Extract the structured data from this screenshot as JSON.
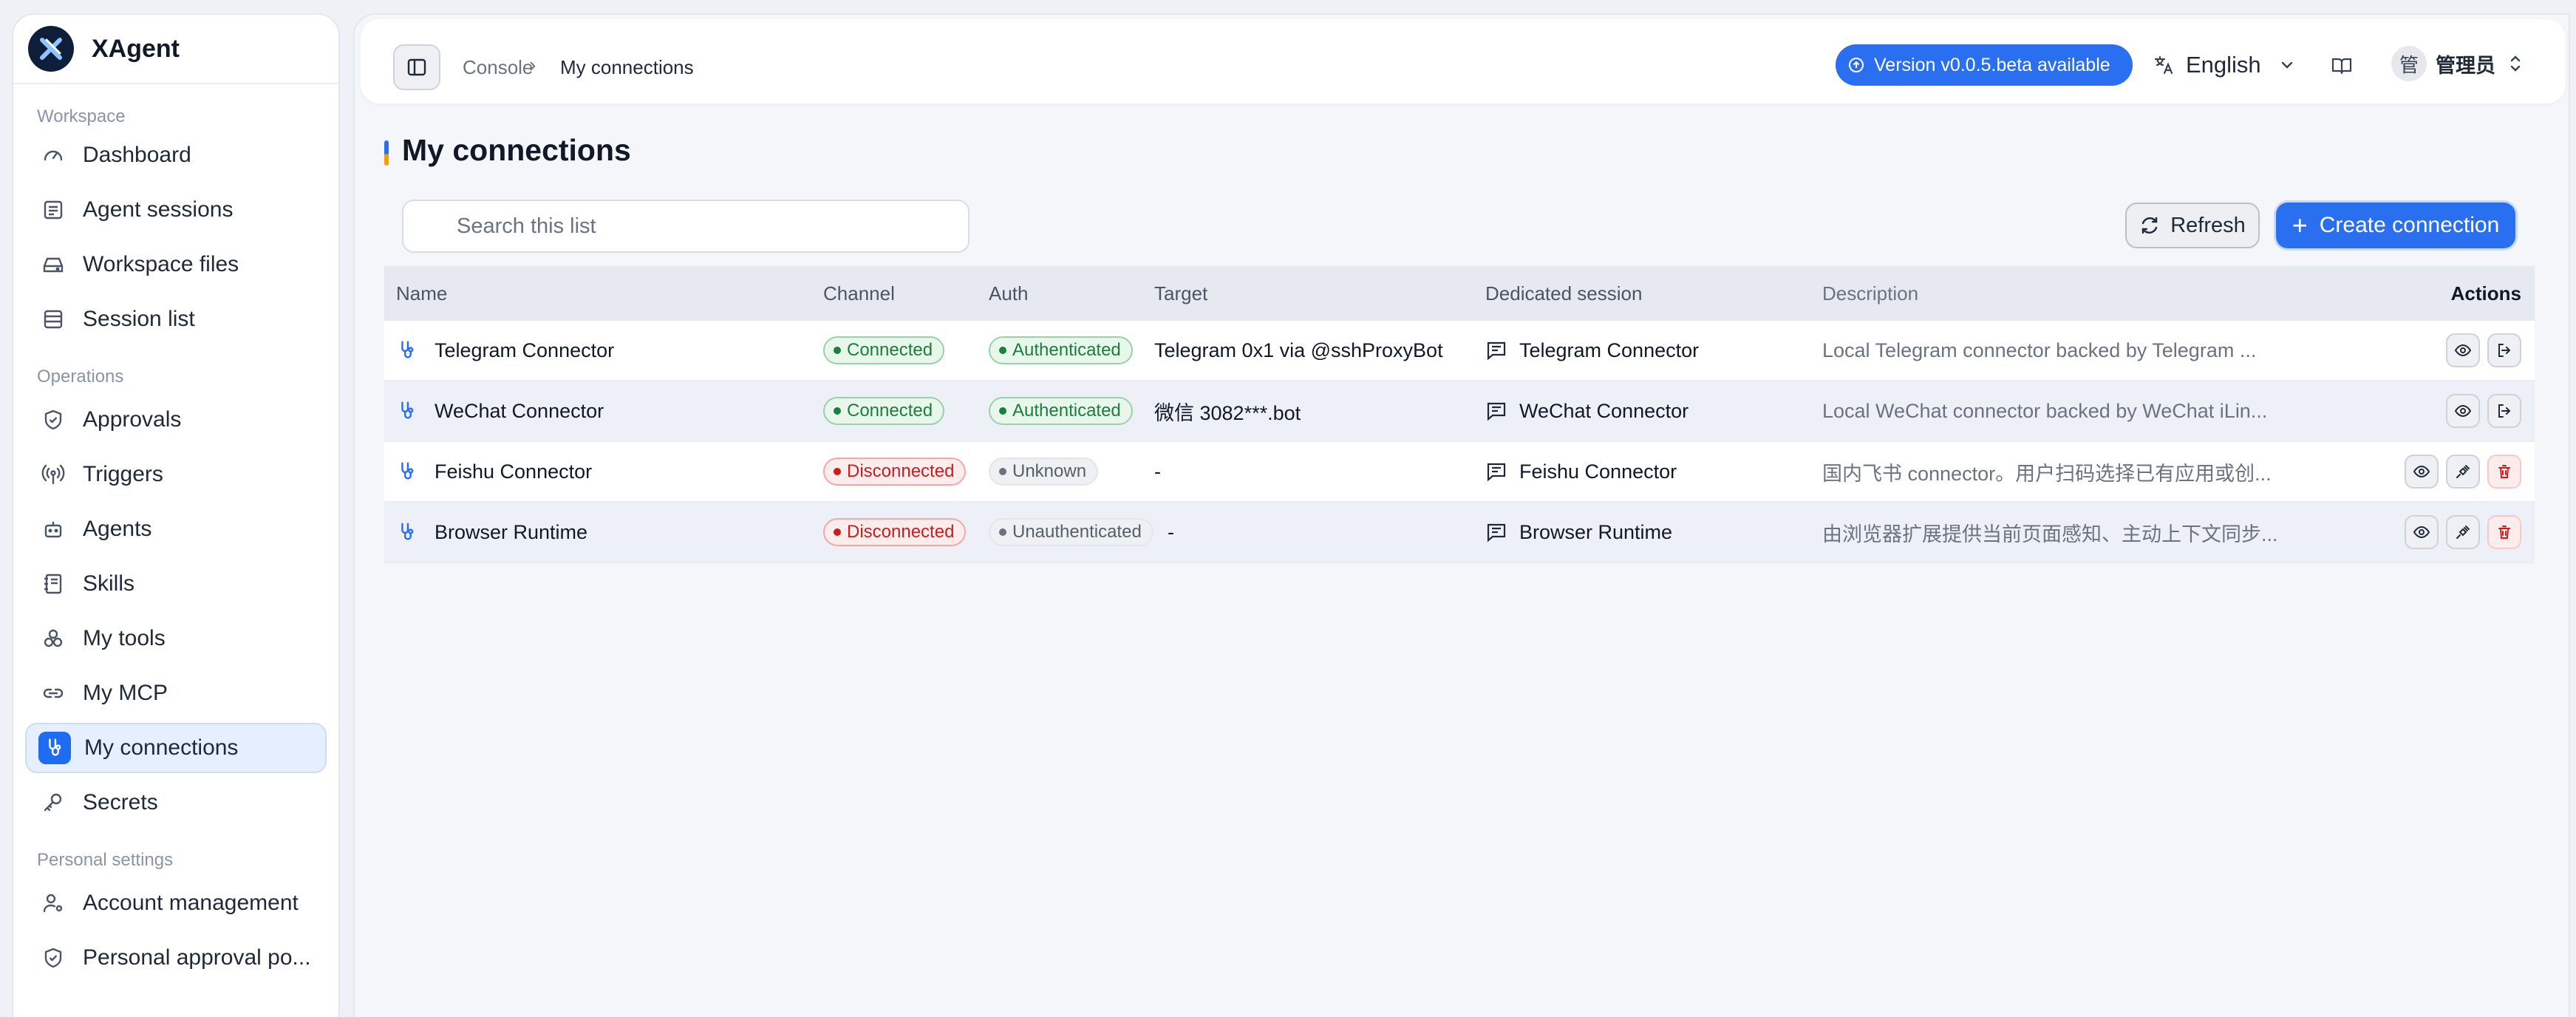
{
  "brand": {
    "name": "XAgent"
  },
  "sidebar": {
    "groups": [
      {
        "label": "Workspace",
        "items": [
          {
            "label": "Dashboard",
            "icon": "gauge-icon"
          },
          {
            "label": "Agent sessions",
            "icon": "sessions-icon"
          },
          {
            "label": "Workspace files",
            "icon": "drive-icon"
          },
          {
            "label": "Session list",
            "icon": "list-icon"
          }
        ]
      },
      {
        "label": "Operations",
        "items": [
          {
            "label": "Approvals",
            "icon": "shield-check-icon"
          },
          {
            "label": "Triggers",
            "icon": "broadcast-icon"
          },
          {
            "label": "Agents",
            "icon": "bot-icon"
          },
          {
            "label": "Skills",
            "icon": "notebook-icon"
          },
          {
            "label": "My tools",
            "icon": "tools-icon"
          },
          {
            "label": "My MCP",
            "icon": "link-icon"
          },
          {
            "label": "My connections",
            "icon": "connection-icon",
            "active": true
          },
          {
            "label": "Secrets",
            "icon": "key-icon"
          }
        ]
      },
      {
        "label": "Personal settings",
        "items": [
          {
            "label": "Account management",
            "icon": "user-cog-icon"
          },
          {
            "label": "Personal approval po...",
            "icon": "shield-check-icon"
          }
        ]
      }
    ]
  },
  "topbar": {
    "breadcrumb": [
      "Console",
      "My connections"
    ],
    "breadcrumb_sep": "›",
    "version_label": "Version v0.0.5.beta available",
    "language": "English",
    "user_avatar": "管",
    "user_name": "管理员"
  },
  "page": {
    "title": "My connections",
    "search_placeholder": "Search this list",
    "refresh_label": "Refresh",
    "create_label": "Create connection"
  },
  "table": {
    "columns": {
      "name": "Name",
      "channel": "Channel",
      "auth": "Auth",
      "target": "Target",
      "session": "Dedicated session",
      "description": "Description",
      "actions": "Actions"
    },
    "rows": [
      {
        "name": "Telegram Connector",
        "channel": "Connected",
        "channel_status": "green",
        "auth": "Authenticated",
        "auth_status": "green",
        "target": "Telegram 0x1 via @sshProxyBot",
        "session": "Telegram Connector",
        "description": "Local Telegram connector backed by Telegram ...",
        "actions": [
          "view",
          "disconnect"
        ]
      },
      {
        "name": "WeChat Connector",
        "channel": "Connected",
        "channel_status": "green",
        "auth": "Authenticated",
        "auth_status": "green",
        "target": "微信 3082***.bot",
        "session": "WeChat Connector",
        "description": "Local WeChat connector backed by WeChat iLin...",
        "actions": [
          "view",
          "disconnect"
        ]
      },
      {
        "name": "Feishu Connector",
        "channel": "Disconnected",
        "channel_status": "red",
        "auth": "Unknown",
        "auth_status": "gray",
        "target": "-",
        "session": "Feishu Connector",
        "description": "国内飞书 connector。用户扫码选择已有应用或创...",
        "actions": [
          "view",
          "connect",
          "delete"
        ]
      },
      {
        "name": "Browser Runtime",
        "channel": "Disconnected",
        "channel_status": "red",
        "auth": "Unauthenticated",
        "auth_status": "gray",
        "target": "-",
        "session": "Browser Runtime",
        "description": "由浏览器扩展提供当前页面感知、主动上下文同步...",
        "actions": [
          "view",
          "connect",
          "delete"
        ]
      }
    ]
  },
  "colors": {
    "accent": "#2a6ff0",
    "success": "#1a7f3a",
    "danger": "#c81e1e"
  }
}
